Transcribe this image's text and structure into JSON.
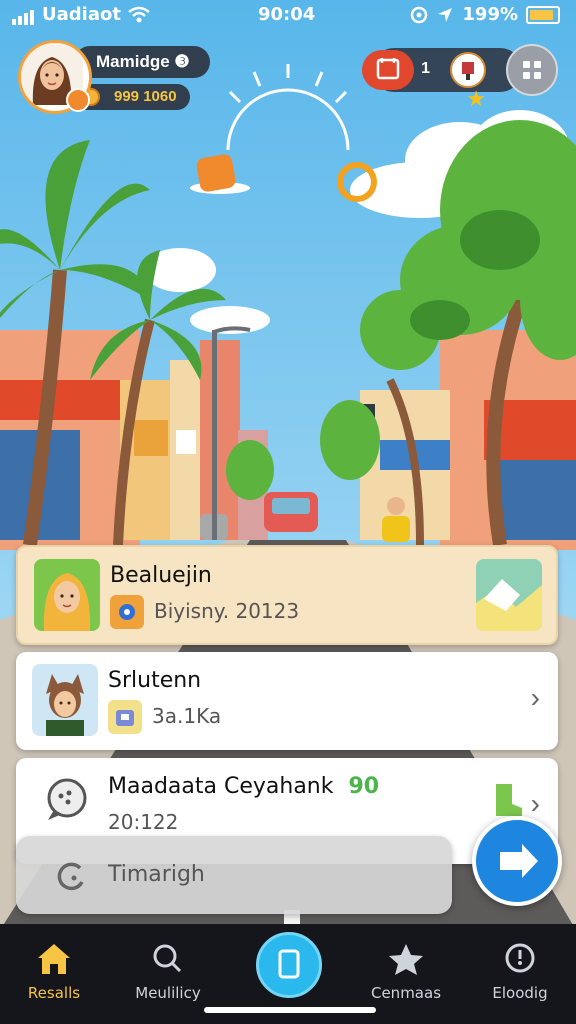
{
  "status_bar": {
    "carrier": "Uadiaot",
    "time": "90:04",
    "battery_percent": "199%",
    "battery_level": 0.9
  },
  "profile": {
    "username": "Mamidge ❸",
    "coins": "999 1060",
    "level_badge_icon": "gear-icon"
  },
  "top_right": {
    "quest_count": "1",
    "quest_icon": "calendar-icon",
    "badge_icon": "trophy-icon",
    "menu_icon": "grid-icon"
  },
  "cards": [
    {
      "title": "Bealuejin",
      "subtitle": "Biyisny. 20123",
      "sub_icon": "camera-icon",
      "right_icon": "map-icon"
    },
    {
      "title": "Srlutenn",
      "subtitle": "3a.1Ka",
      "sub_icon": "bag-icon",
      "right_icon": "chevron-right-icon"
    },
    {
      "title": "Maadaata Ceyahank",
      "badge": "90",
      "subtitle": "20:122",
      "sub_icon": "bubble-icon",
      "right_icon": "chevron-right-icon"
    }
  ],
  "search": {
    "placeholder": "Timarigh"
  },
  "tabs": [
    {
      "label": "Resalls",
      "icon": "home-icon",
      "active": true
    },
    {
      "label": "Meulilicy",
      "icon": "search-icon",
      "active": false
    },
    {
      "label": "",
      "icon": "tablet-icon",
      "active": false
    },
    {
      "label": "Cenmaas",
      "icon": "star-icon",
      "active": false
    },
    {
      "label": "Eloodig",
      "icon": "clock-icon",
      "active": false
    }
  ],
  "colors": {
    "accent": "#f7c443",
    "fab_blue": "#1f86e0",
    "highlight_card": "#f6e4c2"
  }
}
